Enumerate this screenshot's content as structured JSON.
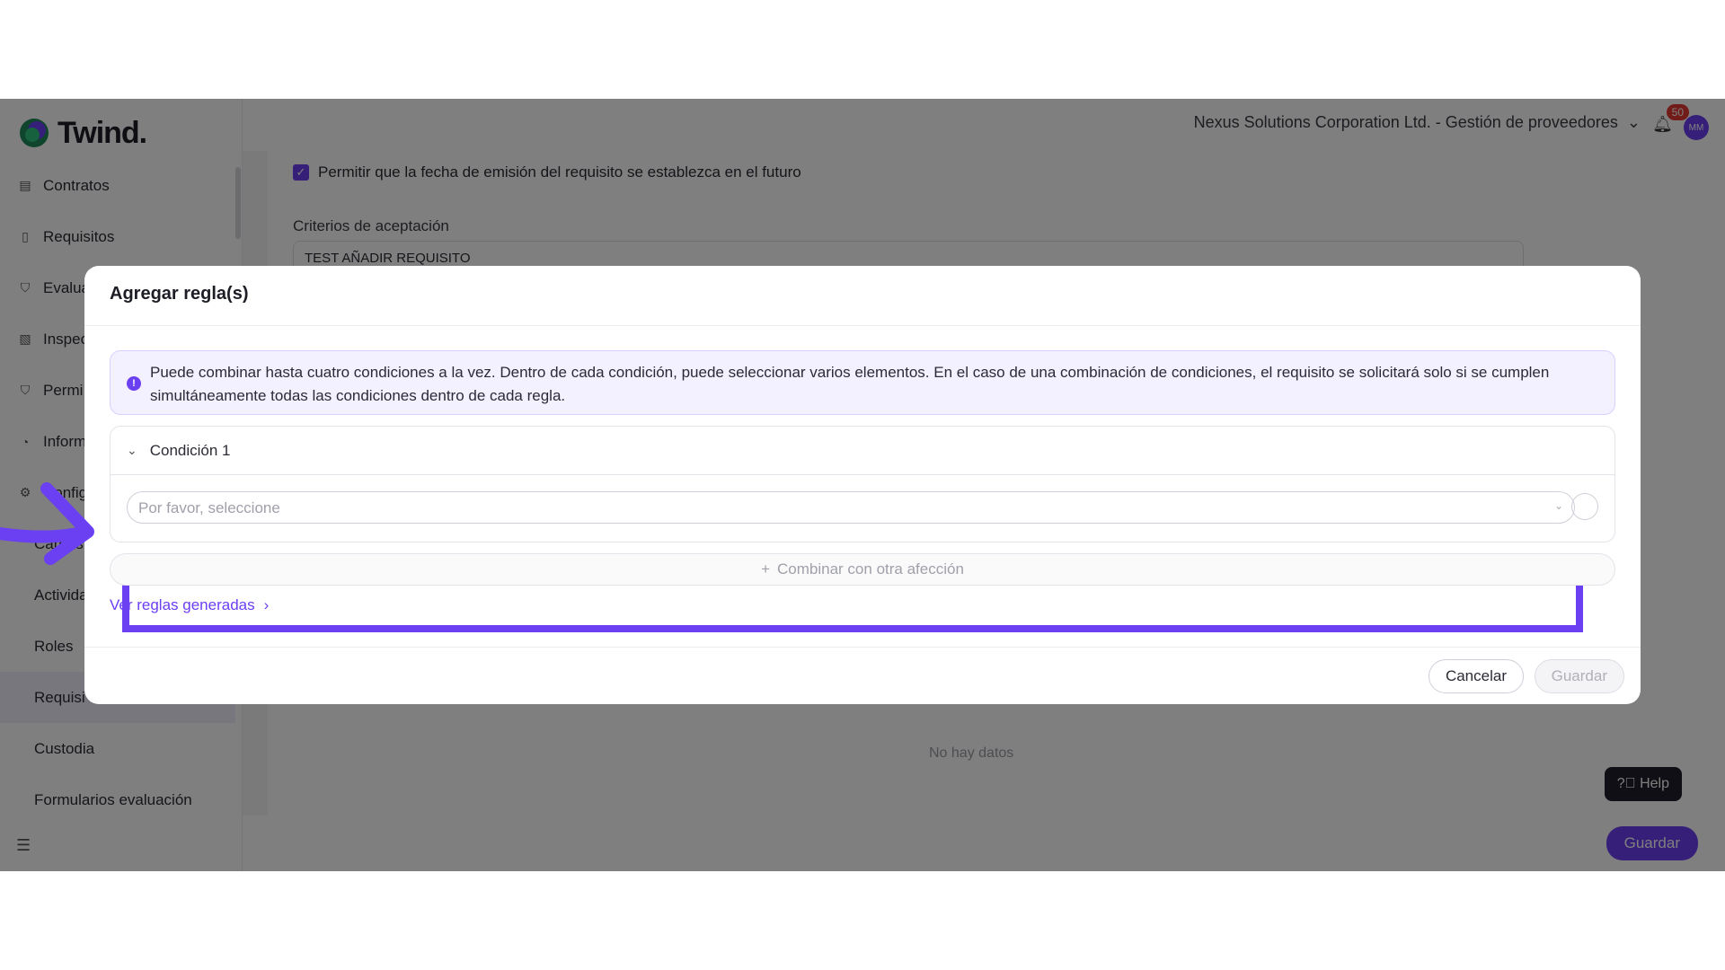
{
  "app": {
    "logo_text": "Twind."
  },
  "header": {
    "org_name": "Nexus Solutions Corporation Ltd. - Gestión de proveedores",
    "notification_count": "50",
    "avatar_initials": "MM"
  },
  "sidebar": {
    "items": [
      {
        "label": "Contratos",
        "icon": "contract-icon"
      },
      {
        "label": "Requisitos",
        "icon": "document-icon"
      },
      {
        "label": "Evalua",
        "icon": "shield-check-icon"
      },
      {
        "label": "Inspec",
        "icon": "clipboard-search-icon"
      },
      {
        "label": "Permi",
        "icon": "shield-icon"
      },
      {
        "label": "Inform",
        "icon": "chart-pie-icon"
      },
      {
        "label": "Config",
        "icon": "gear-icon"
      }
    ],
    "sub_items": [
      {
        "label": "Cargos"
      },
      {
        "label": "Activida"
      },
      {
        "label": "Roles"
      },
      {
        "label": "Requisi"
      },
      {
        "label": "Custodia"
      },
      {
        "label": "Formularios evaluación"
      }
    ]
  },
  "main": {
    "checkbox_label": "Permitir que la fecha de emisión del requisito se establezca en el futuro",
    "criteria_label": "Criterios de aceptación",
    "criteria_value": "TEST AÑADIR REQUISITO",
    "no_data": "No hay datos",
    "help_label": "Help",
    "save_label": "Guardar"
  },
  "modal": {
    "title": "Agregar regla(s)",
    "info_text": "Puede combinar hasta cuatro condiciones a la vez. Dentro de cada condición, puede seleccionar varios elementos. En el caso de una combinación de condiciones, el requisito se solicitará solo si se cumplen simultáneamente todas las condiciones dentro de cada regla.",
    "condition_title": "Condición 1",
    "select_placeholder": "Por favor, seleccione",
    "combine_label": "Combinar con otra afección",
    "view_rules_label": "Ver reglas generadas",
    "cancel_label": "Cancelar",
    "save_label": "Guardar"
  },
  "colors": {
    "accent": "#6b3ff2",
    "badge": "#e53935"
  }
}
